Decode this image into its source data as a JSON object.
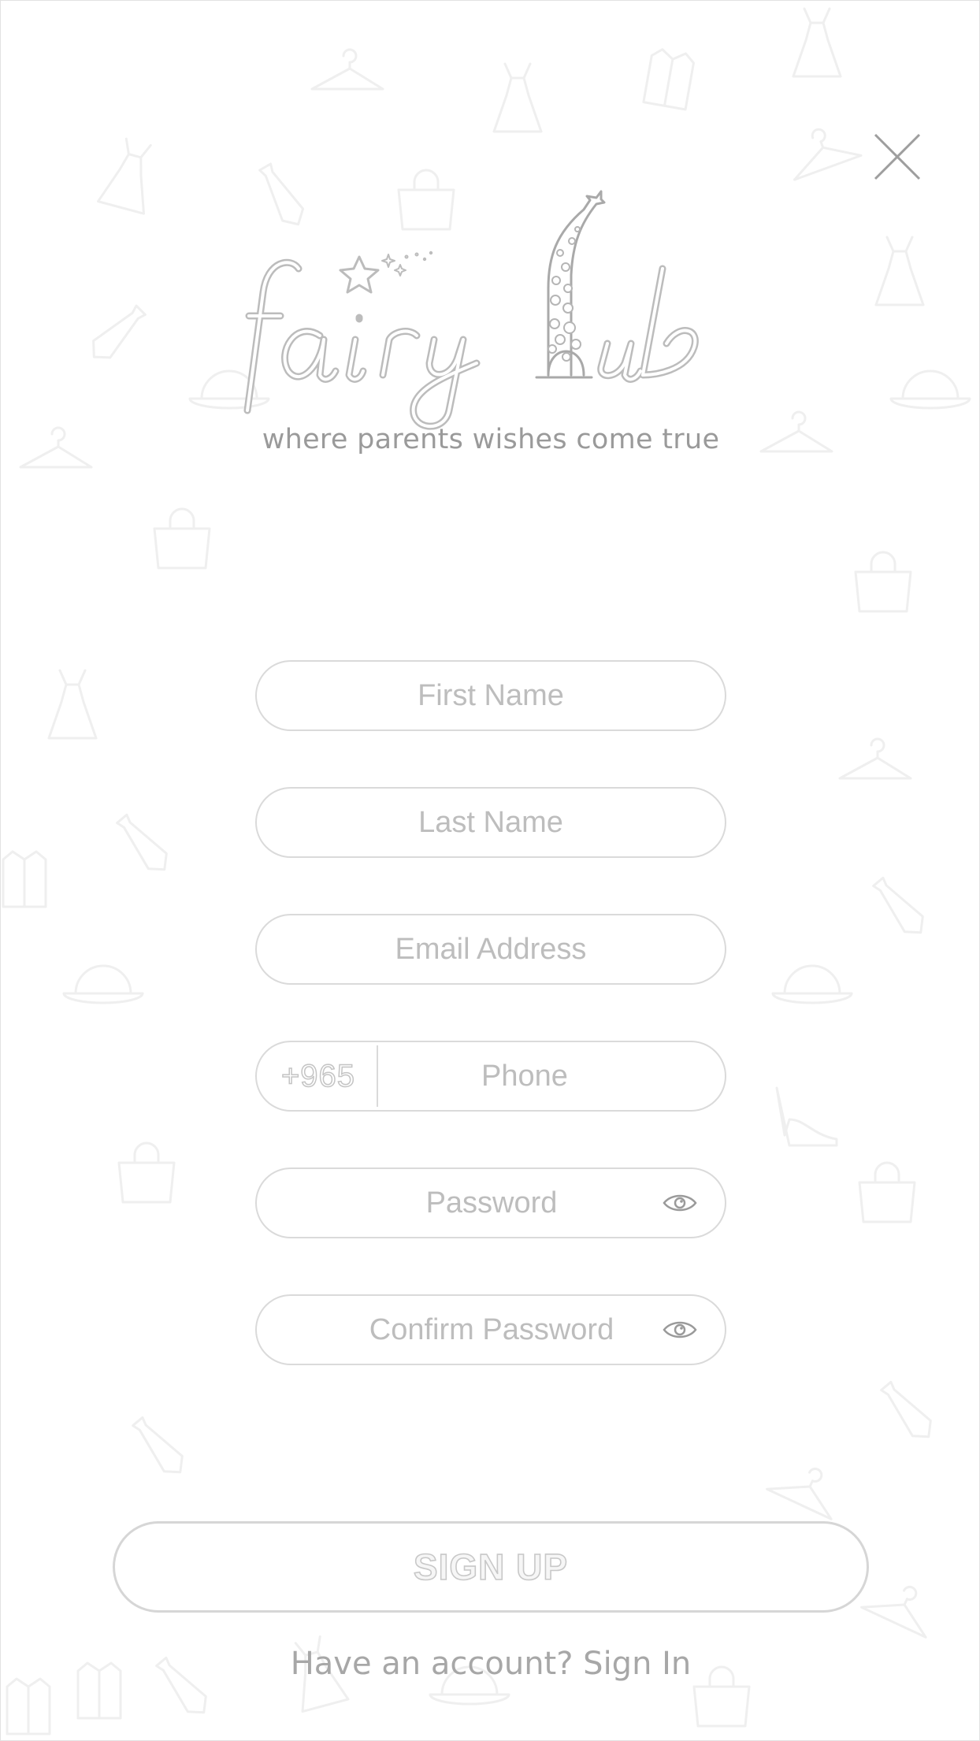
{
  "logo": {
    "text": "fairy hub",
    "tagline": "where parents wishes come true"
  },
  "form": {
    "first_name_placeholder": "First Name",
    "last_name_placeholder": "Last Name",
    "email_placeholder": "Email Address",
    "country_code": "+965",
    "phone_placeholder": "Phone",
    "password_placeholder": "Password",
    "confirm_password_placeholder": "Confirm Password"
  },
  "actions": {
    "signup_label": "SIGN UP",
    "have_account_text": "Have an account?",
    "signin_label": "Sign In"
  },
  "icons": {
    "close": "close-icon",
    "password_toggle": "eye-icon"
  },
  "colors": {
    "background": "#ffffff",
    "border": "#dadada",
    "text_muted": "#bdbdbd"
  }
}
